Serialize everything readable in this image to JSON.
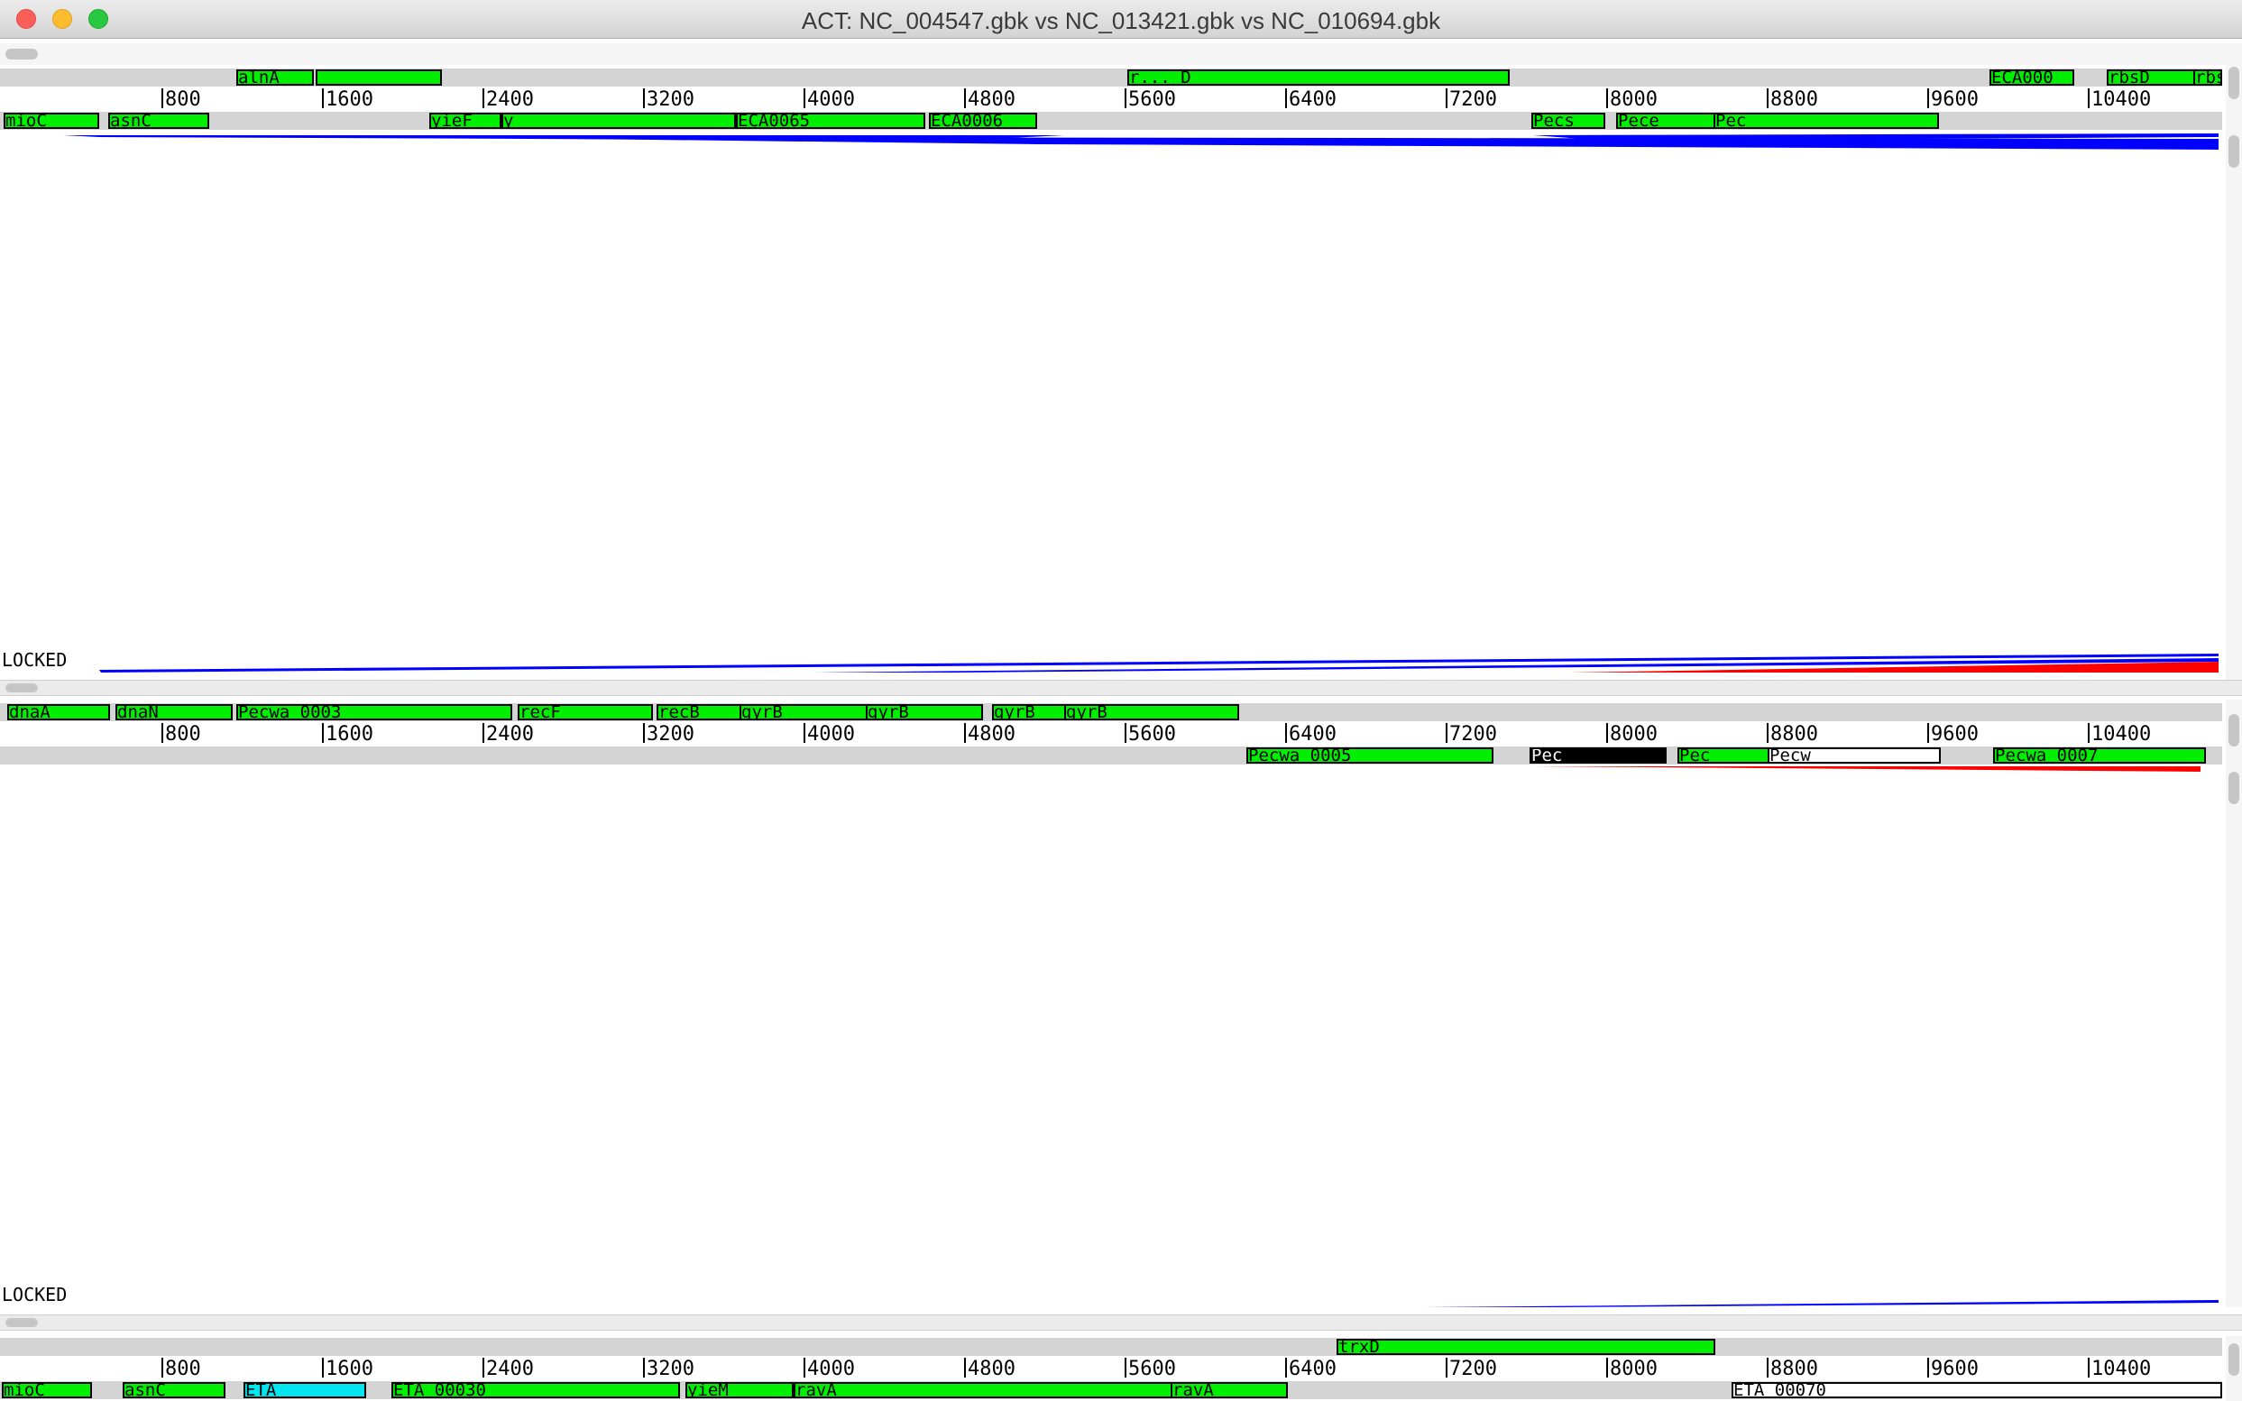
{
  "window": {
    "title": "ACT: NC_004547.gbk vs NC_013421.gbk vs NC_010694.gbk"
  },
  "ruler_ticks": [
    "800",
    "1600",
    "2400",
    "3200",
    "4000",
    "4800",
    "5600",
    "6400",
    "7200",
    "8000",
    "8800",
    "9600",
    "10400"
  ],
  "genome1": {
    "forward_genes": [
      {
        "label": "alnA"
      },
      {
        "label": "r... D"
      },
      {
        "label": "ECA000"
      },
      {
        "label": "rbsD"
      },
      {
        "label": "rbsA"
      }
    ],
    "reverse_genes": [
      {
        "label": "mioC"
      },
      {
        "label": "asnC"
      },
      {
        "label": "yieF"
      },
      {
        "label": "y"
      },
      {
        "label": "ECA0065"
      },
      {
        "label": "ECA0006"
      },
      {
        "label": "Pecs"
      },
      {
        "label": "Pece"
      },
      {
        "label": "Pec"
      }
    ]
  },
  "panel1": {
    "locked_label": "LOCKED"
  },
  "genome2": {
    "forward_genes": [
      {
        "label": "dnaA"
      },
      {
        "label": "dnaN"
      },
      {
        "label": "Pecwa 0003"
      },
      {
        "label": "recF"
      },
      {
        "label": "recB"
      },
      {
        "label": "gyrB"
      },
      {
        "label": "gyrB"
      },
      {
        "label": "gyrB"
      },
      {
        "label": "gyrB"
      }
    ],
    "reverse_genes": [
      {
        "label": "Pecwa 0005"
      },
      {
        "label": "Pec"
      },
      {
        "label": "Pec"
      },
      {
        "label": "Pecw"
      },
      {
        "label": "Pecwa 0007"
      }
    ]
  },
  "panel2": {
    "locked_label": "LOCKED"
  },
  "genome3": {
    "forward_genes": [
      {
        "label": "trxD"
      }
    ],
    "reverse_genes": [
      {
        "label": "mioC"
      },
      {
        "label": "asnC"
      },
      {
        "label": "ETA"
      },
      {
        "label": "ETA 00030"
      },
      {
        "label": "yieM"
      },
      {
        "label": "ravA"
      },
      {
        "label": "ravA"
      },
      {
        "label": "ETA 00070"
      }
    ]
  },
  "colors": {
    "gene_feature": "#00ee00",
    "cyan_feature": "#00e5ee",
    "forward_match": "#0000ff",
    "reverse_match": "#ff0000",
    "band": "#d4d4d4"
  }
}
